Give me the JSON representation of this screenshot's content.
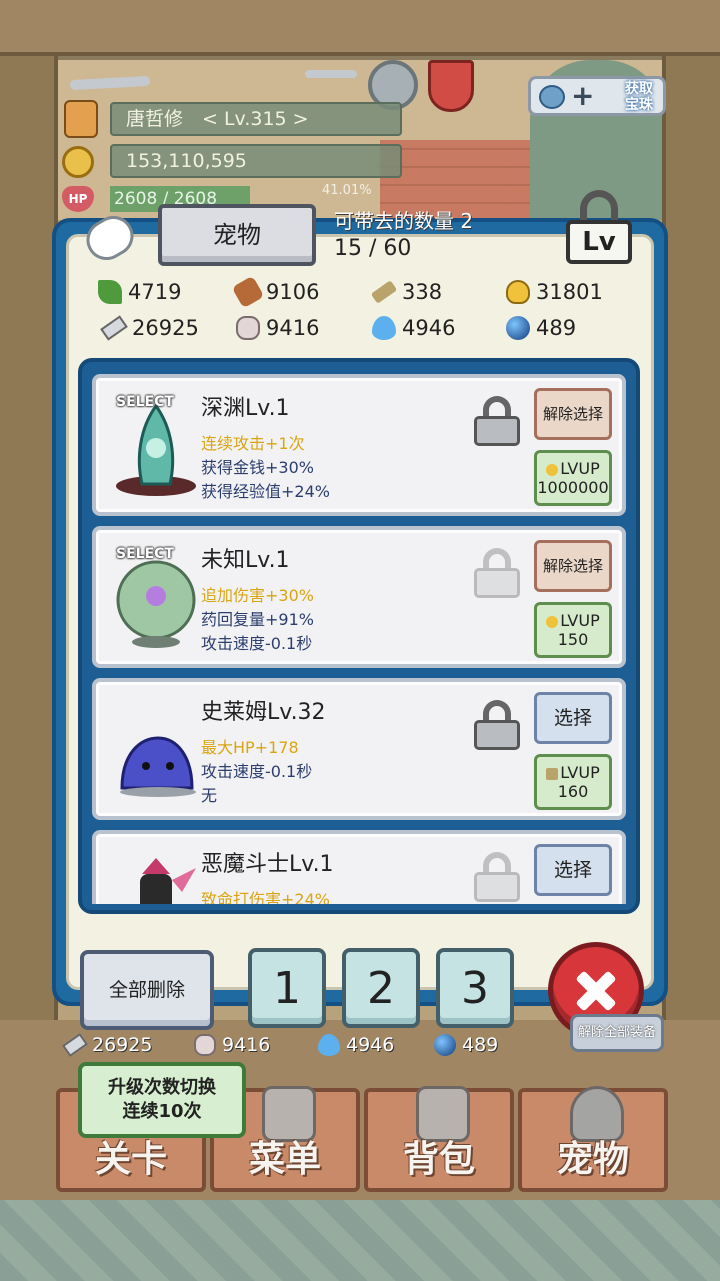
{
  "player": {
    "name_level": "唐哲修　< Lv.315 >",
    "gold": "153,110,595",
    "hp": "2608 / 2608",
    "exp_percent": "41.01%",
    "hp_icon_label": "HP"
  },
  "header_buttons": {
    "get_gems": "获取\n宝珠"
  },
  "dialog": {
    "title": "宠物",
    "carry_label": "可带去的数量 2",
    "carry_count": "15 / 60",
    "lv_lock_label": "Lv"
  },
  "resources": [
    {
      "icon": "herb-icon",
      "value": "4719"
    },
    {
      "icon": "wood-log-icon",
      "value": "9106"
    },
    {
      "icon": "plank-icon",
      "value": "338"
    },
    {
      "icon": "potion-icon",
      "value": "31801"
    },
    {
      "icon": "iron-bar-icon",
      "value": "26925"
    },
    {
      "icon": "stone-icon",
      "value": "9416"
    },
    {
      "icon": "blue-flame-icon",
      "value": "4946"
    },
    {
      "icon": "dark-orb-icon",
      "value": "489"
    }
  ],
  "pets": [
    {
      "select_tag": "SELECT",
      "name": "深渊Lv.1",
      "stats": [
        "连续攻击+1次",
        "获得金钱+30%",
        "获得经验值+24%"
      ],
      "locked": true,
      "action": "解除选择",
      "lvup_label": "LVUP",
      "lvup_cost": "1000000",
      "img_color": "#5fb8a8"
    },
    {
      "select_tag": "SELECT",
      "name": "未知Lv.1",
      "stats": [
        "追加伤害+30%",
        "药回复量+91%",
        "攻击速度-0.1秒"
      ],
      "locked": false,
      "action": "解除选择",
      "lvup_label": "LVUP",
      "lvup_cost": "150",
      "img_color": "#9fc7a4"
    },
    {
      "select_tag": "",
      "name": "史莱姆Lv.32",
      "stats": [
        "最大HP+178",
        "攻击速度-0.1秒",
        "无"
      ],
      "locked": true,
      "action": "选择",
      "lvup_label": "LVUP",
      "lvup_cost": "160",
      "img_color": "#4b4fc8"
    },
    {
      "select_tag": "",
      "name": "恶魔斗士Lv.1",
      "stats": [
        "致命打伤害+24%",
        "",
        ""
      ],
      "locked": false,
      "action": "选择",
      "lvup_label": "",
      "lvup_cost": "",
      "img_color": "#2a2a2a"
    }
  ],
  "dialog_buttons": {
    "delete_all": "全部删除",
    "slot_1": "1",
    "slot_2": "2",
    "slot_3": "3"
  },
  "below": {
    "iron": "26925",
    "stone": "9416",
    "flame": "4946",
    "orb": "489",
    "unequip_all": "解除全部装备",
    "upgrade_toggle_line1": "升级次数切换",
    "upgrade_toggle_line2": "连续10次"
  },
  "nav": {
    "stage": "关卡",
    "menu": "菜单",
    "bag": "背包",
    "pets": "宠物"
  }
}
